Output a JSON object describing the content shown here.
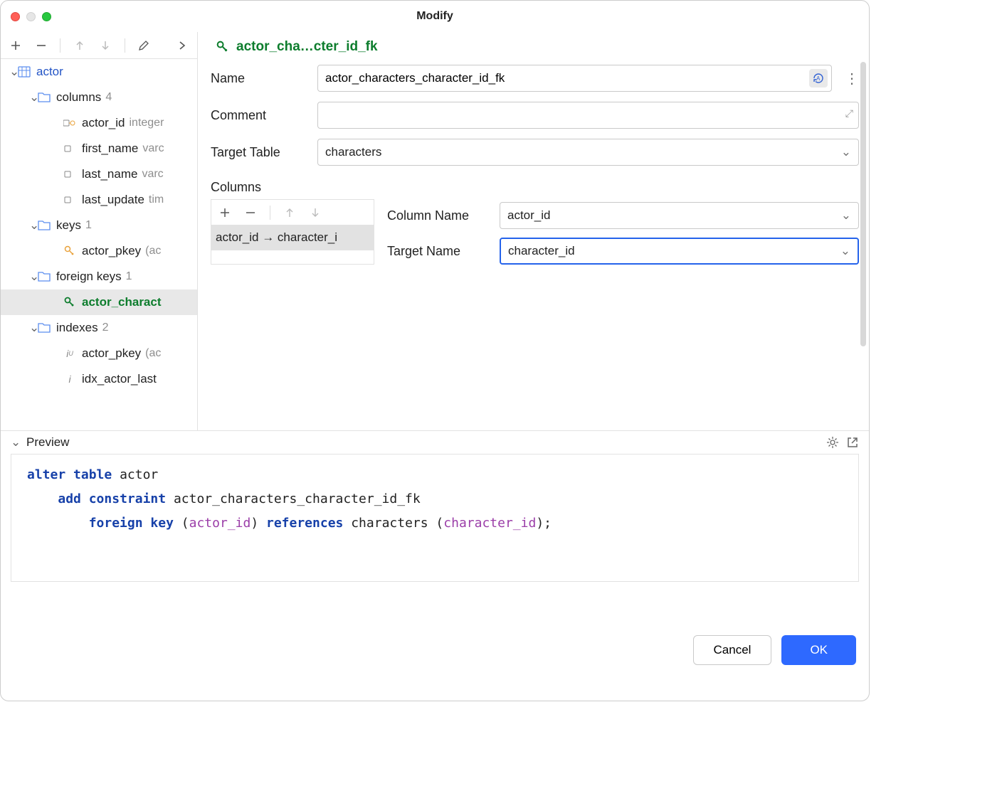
{
  "window": {
    "title": "Modify"
  },
  "header": {
    "fk_label": "actor_cha…cter_id_fk"
  },
  "tree": {
    "table_name": "actor",
    "columns_label": "columns",
    "columns_count": "4",
    "columns": [
      {
        "name": "actor_id",
        "type": "integer"
      },
      {
        "name": "first_name",
        "type": "varc"
      },
      {
        "name": "last_name",
        "type": "varc"
      },
      {
        "name": "last_update",
        "type": "tim"
      }
    ],
    "keys_label": "keys",
    "keys_count": "1",
    "keys": [
      {
        "name": "actor_pkey",
        "suffix": "(ac"
      }
    ],
    "fk_label": "foreign keys",
    "fk_count": "1",
    "fks": [
      {
        "name": "actor_charact"
      }
    ],
    "indexes_label": "indexes",
    "indexes_count": "2",
    "indexes": [
      {
        "name": "actor_pkey",
        "suffix": "(ac"
      },
      {
        "name": "idx_actor_last"
      }
    ]
  },
  "form": {
    "name_label": "Name",
    "name_value": "actor_characters_character_id_fk",
    "comment_label": "Comment",
    "comment_value": "",
    "target_table_label": "Target Table",
    "target_table_value": "characters",
    "columns_label": "Columns",
    "mapping": "actor_id → character_i",
    "column_name_label": "Column Name",
    "column_name_value": "actor_id",
    "target_name_label": "Target Name",
    "target_name_value": "character_id"
  },
  "preview": {
    "label": "Preview",
    "sql": {
      "l1a": "alter",
      "l1b": "table",
      "l1c": "actor",
      "l2a": "add",
      "l2b": "constraint",
      "l2c": "actor_characters_character_id_fk",
      "l3a": "foreign",
      "l3b": "key",
      "l3c": "(",
      "l3d": "actor_id",
      "l3e": ") ",
      "l3f": "references",
      "l3g": "characters (",
      "l3h": "character_id",
      "l3i": ");"
    }
  },
  "buttons": {
    "cancel": "Cancel",
    "ok": "OK"
  }
}
